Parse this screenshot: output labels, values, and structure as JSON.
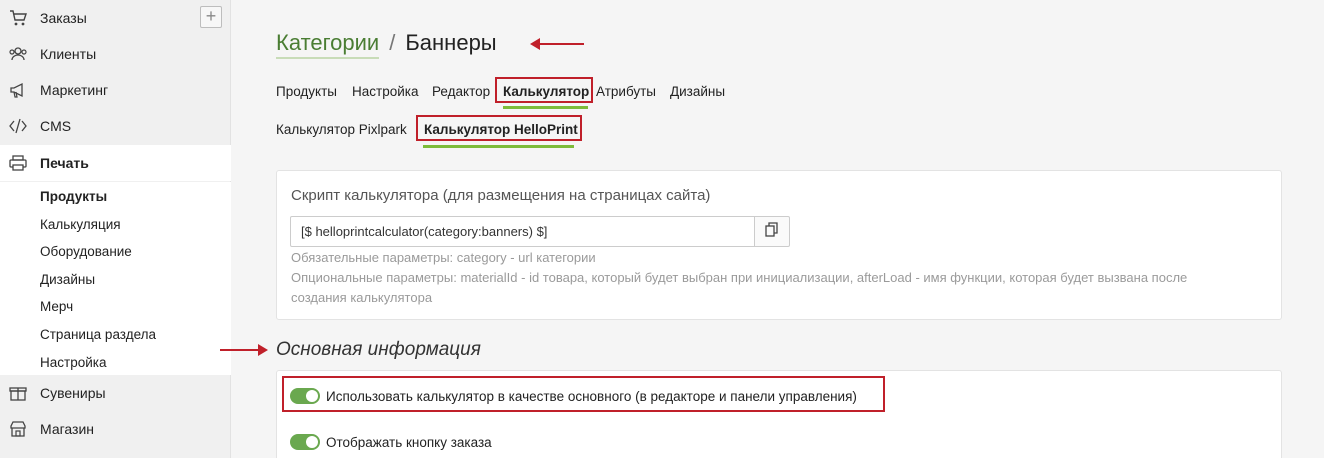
{
  "sidebar": {
    "items": [
      {
        "label": "Заказы",
        "icon": "cart-icon"
      },
      {
        "label": "Клиенты",
        "icon": "users-icon"
      },
      {
        "label": "Маркетинг",
        "icon": "megaphone-icon"
      },
      {
        "label": "CMS",
        "icon": "code-icon"
      },
      {
        "label": "Печать",
        "icon": "printer-icon"
      },
      {
        "label": "Сувениры",
        "icon": "gift-icon"
      },
      {
        "label": "Магазин",
        "icon": "store-icon"
      }
    ],
    "add_label": "+",
    "sub_items": [
      "Продукты",
      "Калькуляция",
      "Оборудование",
      "Дизайны",
      "Мерч",
      "Страница раздела",
      "Настройка"
    ]
  },
  "breadcrumb": {
    "parent": "Категории",
    "separator": "/",
    "current": "Баннеры"
  },
  "tabs": [
    "Продукты",
    "Настройка",
    "Редактор",
    "Калькулятор",
    "Атрибуты",
    "Дизайны"
  ],
  "subtabs": [
    "Калькулятор Pixlpark",
    "Калькулятор HelloPrint"
  ],
  "script_card": {
    "title": "Скрипт калькулятора (для размещения на страницах сайта)",
    "code": "[$ helloprintcalculator(category:banners) $]",
    "required_params": "Обязательные параметры: category - url категории",
    "optional_params_line1": "Опциональные параметры: materialId - id товара, который будет выбран при инициализации, afterLoad - имя функции, которая будет вызвана после",
    "optional_params_line2": "создания калькулятора"
  },
  "main_info": {
    "title": "Основная информация",
    "toggle1": "Использовать калькулятор в качестве основного (в редакторе и панели управления)",
    "toggle2": "Отображать кнопку заказа"
  },
  "colors": {
    "accent_green": "#4a7d33",
    "highlight_red": "#c0202a",
    "toggle_green": "#6aa84f"
  }
}
